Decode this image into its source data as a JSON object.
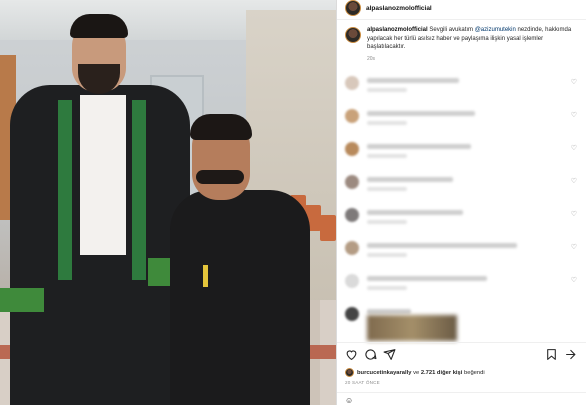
{
  "post": {
    "username": "alpaslanozmolofficial",
    "caption_user": "alpaslanozmolofficial",
    "caption_pre": " Sevgili avukatım ",
    "mention": "@azizumutekin",
    "caption_post": " nezdinde, hakkımda yapılacak her türlü asılsız haber ve paylaşıma ilişkin yasal işlemler başlatılacaktır.",
    "caption_age": "20s",
    "liked_by_user": "burcucetinkayarally",
    "liked_by_connector": " ve ",
    "liked_by_others": "2.721 diğer kişi",
    "liked_by_suffix": " beğendi",
    "time_ago": "20 SAAT ÖNCE"
  },
  "comments": [
    {
      "av": "#d8c8bb",
      "w": 92
    },
    {
      "av": "#c9a27a",
      "w": 108
    },
    {
      "av": "#b88a5c",
      "w": 104
    },
    {
      "av": "#9c8a80",
      "w": 86
    },
    {
      "av": "#7e7a7a",
      "w": 96
    },
    {
      "av": "#b49c84",
      "w": 150
    },
    {
      "av": "#dadada",
      "w": 120
    },
    {
      "av": "#444444",
      "w": 44
    }
  ],
  "icons": [
    "heart-icon",
    "comment-icon",
    "share-icon",
    "bookmark-icon",
    "more-icon"
  ],
  "colors": {
    "mention": "#00376b",
    "muted": "#8e8e8e",
    "green_sash": "#2e7a3e"
  }
}
